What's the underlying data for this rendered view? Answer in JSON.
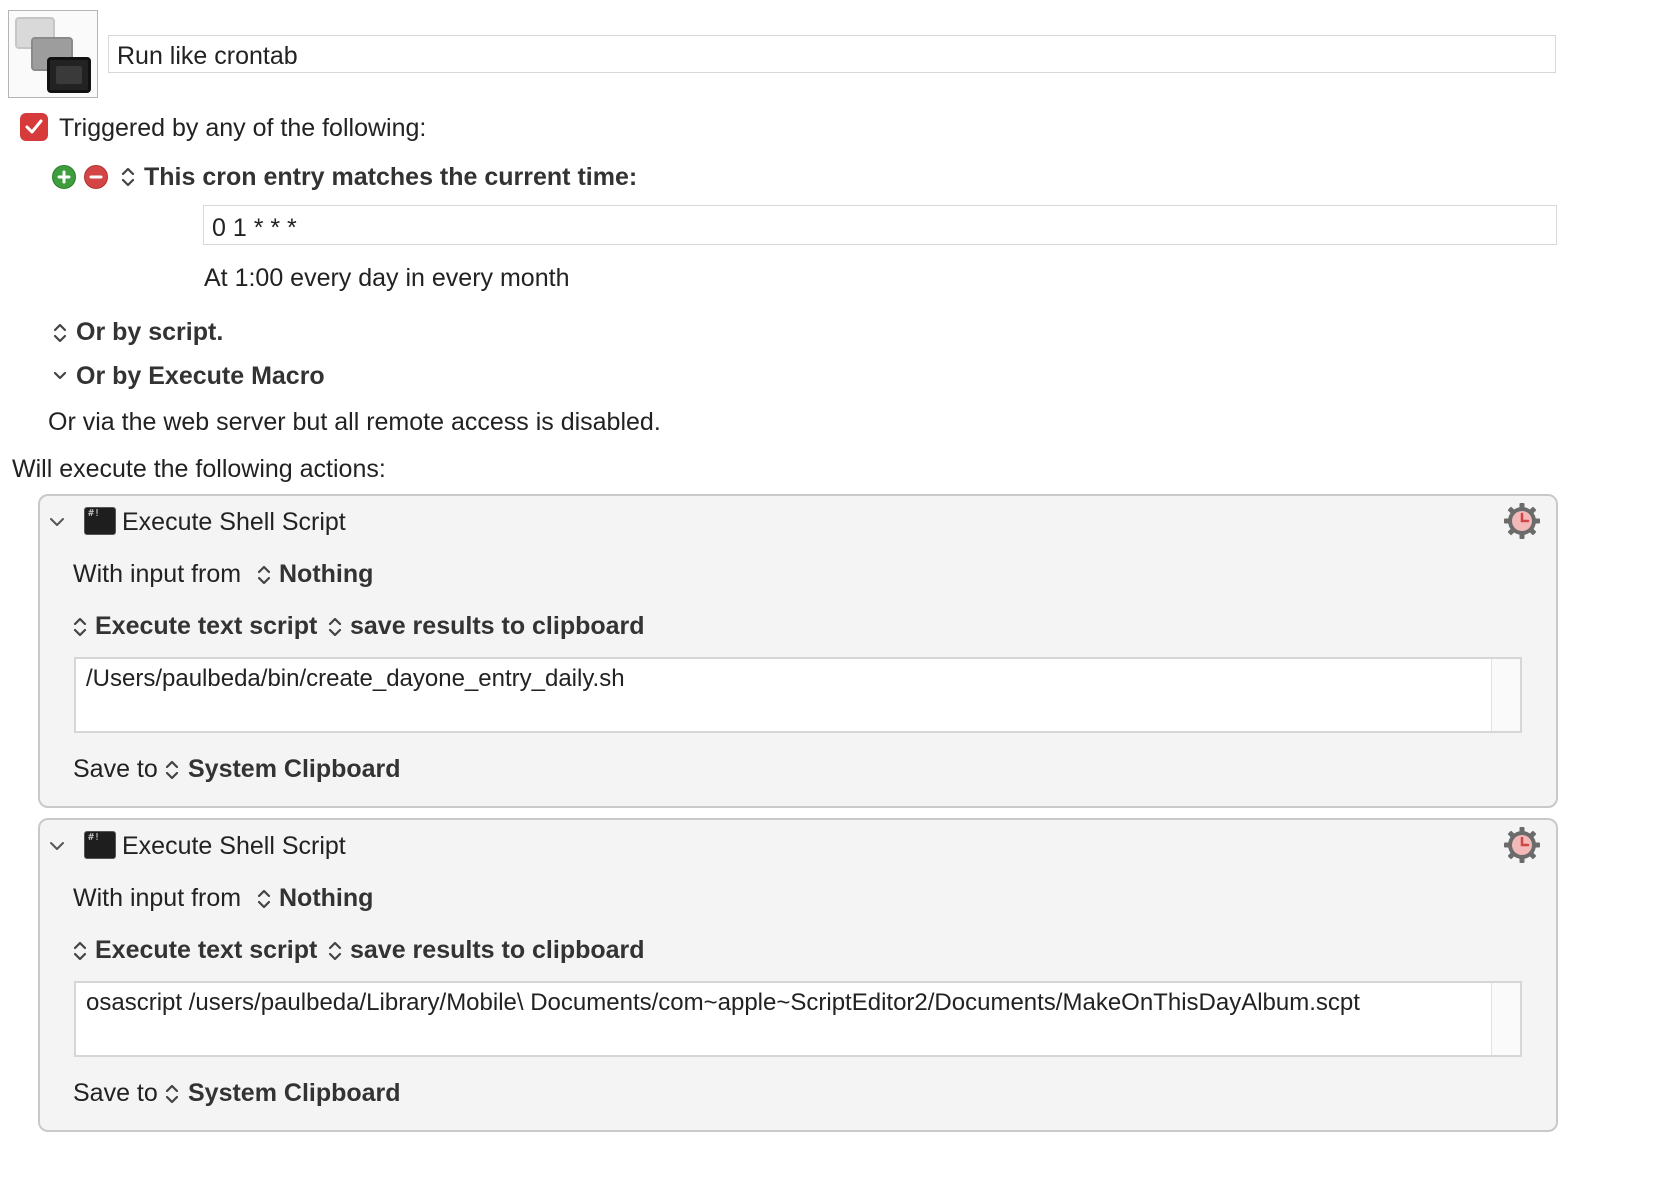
{
  "macro": {
    "name": "Run like crontab"
  },
  "trigger": {
    "checked": true,
    "heading": "Triggered by any of the following:",
    "cron_label": "This cron entry matches the current time:",
    "cron_value": "0 1 * * *",
    "cron_description": "At 1:00 every day in every month",
    "or_by_script": "Or by script.",
    "or_by_execute_macro": "Or by Execute Macro",
    "web_server_note": "Or via the web server but all remote access is disabled."
  },
  "actions_heading": "Will execute the following actions:",
  "actions": [
    {
      "title": "Execute Shell Script",
      "input_label": "With input from",
      "input_value": "Nothing",
      "mode": "Execute text script",
      "result": "save results to clipboard",
      "script": "/Users/paulbeda/bin/create_dayone_entry_daily.sh",
      "save_label": "Save to",
      "save_value": "System Clipboard"
    },
    {
      "title": "Execute Shell Script",
      "input_label": "With input from",
      "input_value": "Nothing",
      "mode": "Execute text script",
      "result": "save results to clipboard",
      "script": "osascript /users/paulbeda/Library/Mobile\\ Documents/com~apple~ScriptEditor2/Documents/MakeOnThisDayAlbum.scpt",
      "save_label": "Save to",
      "save_value": "System Clipboard"
    }
  ],
  "colors": {
    "checkbox": "#d63a3a",
    "add_button": "#3e9e3e",
    "remove_button": "#d44545",
    "gear": "#6b6b6b",
    "clock_accent": "#e06b6b"
  },
  "icons": {
    "macro": "stacked-windows-icon",
    "add": "plus-circle-icon",
    "remove": "minus-circle-icon",
    "stepper": "up-down-chevron-icon",
    "disclosure": "chevron-down-icon",
    "action": "terminal-icon",
    "gear": "gear-clock-icon"
  }
}
